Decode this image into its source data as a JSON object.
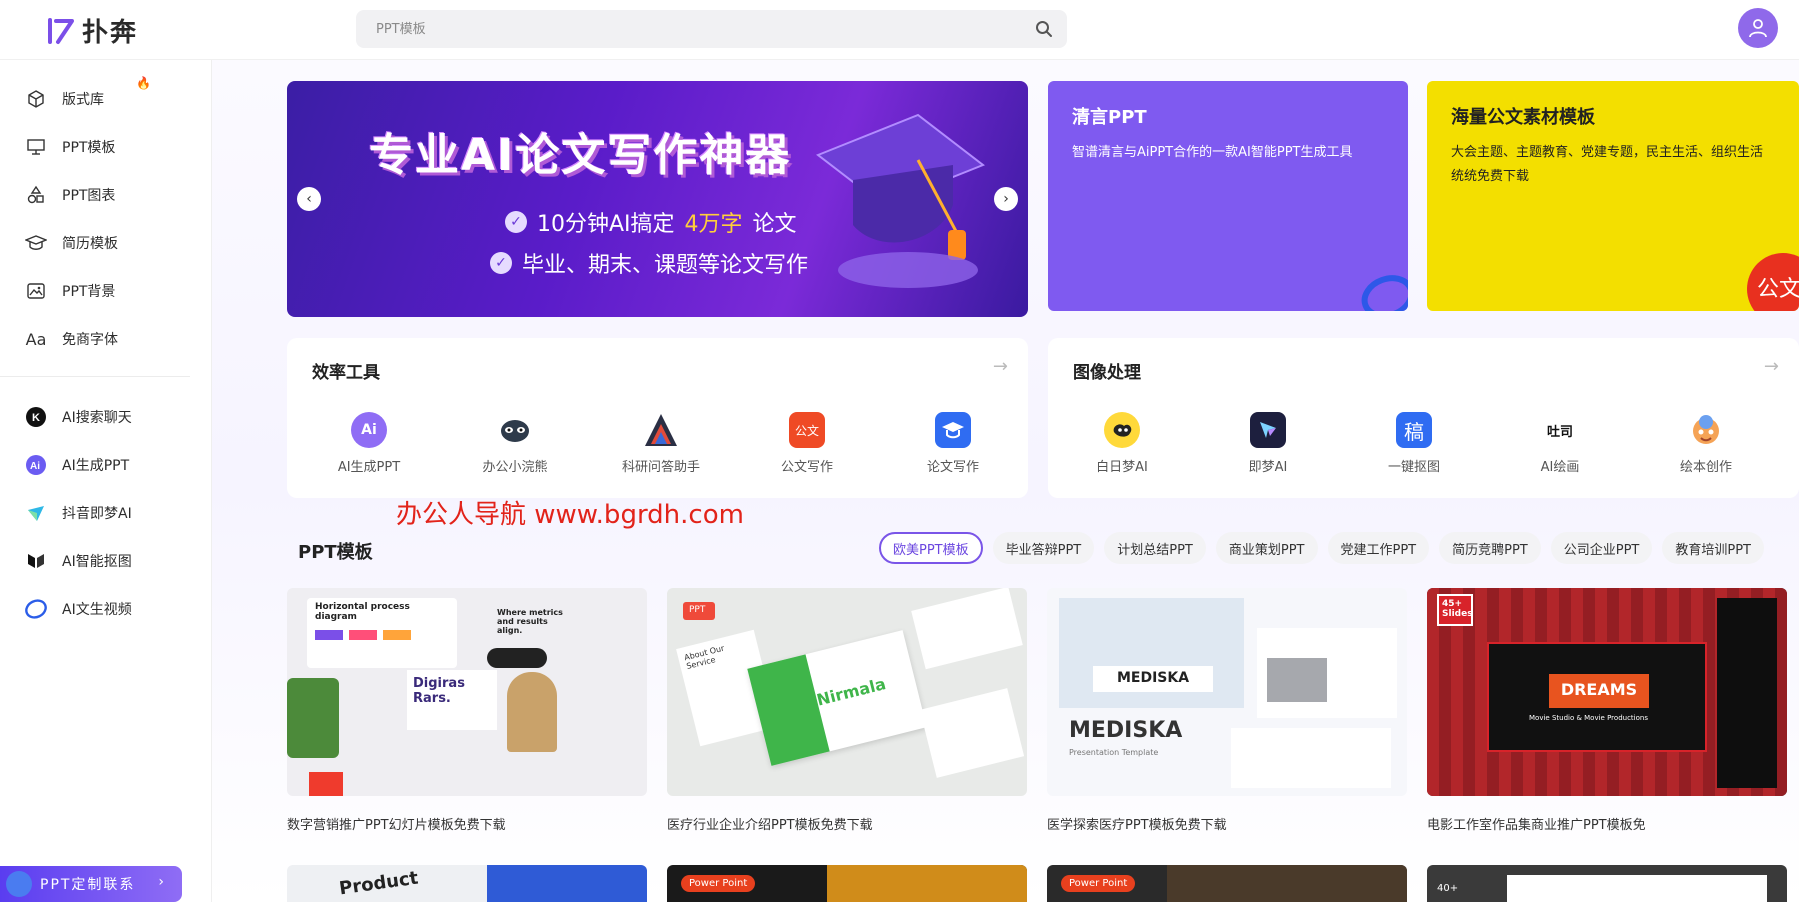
{
  "header": {
    "logo_text": "扑奔",
    "search_placeholder": "PPT模板"
  },
  "sidebar": {
    "items": [
      {
        "label": "版式库"
      },
      {
        "label": "PPT模板"
      },
      {
        "label": "PPT图表"
      },
      {
        "label": "简历模板"
      },
      {
        "label": "PPT背景"
      },
      {
        "label": "免商字体"
      },
      {
        "label": "AI搜索聊天"
      },
      {
        "label": "AI生成PPT"
      },
      {
        "label": "抖音即梦AI"
      },
      {
        "label": "AI智能抠图"
      },
      {
        "label": "AI文生视频"
      }
    ],
    "custom_button": "PPT定制联系"
  },
  "banner": {
    "title": "专业AI论文写作神器",
    "line1_pre": "10分钟AI搞定",
    "line1_hl": "4万字",
    "line1_post": "论文",
    "line2": "毕业、期末、课题等论文写作"
  },
  "promos": [
    {
      "title": "清言PPT",
      "desc": "智谱清言与AiPPT合作的一款AI智能PPT生成工具",
      "color": "#7f5af0"
    },
    {
      "title": "海量公文素材模板",
      "desc": "大会主题、主题教育、党建专题，民主生活、组织生活统统免费下载",
      "color": "#f5e000",
      "badge": "公文"
    }
  ],
  "efficiency": {
    "title": "效率工具",
    "tools": [
      {
        "label": "AI生成PPT",
        "icon": "AI"
      },
      {
        "label": "办公小浣熊",
        "icon": "raccoon"
      },
      {
        "label": "科研问答助手",
        "icon": "A"
      },
      {
        "label": "公文写作",
        "icon": "公文"
      },
      {
        "label": "论文写作",
        "icon": "cap"
      }
    ]
  },
  "image_tools": {
    "title": "图像处理",
    "tools": [
      {
        "label": "白日梦AI",
        "icon": "dream"
      },
      {
        "label": "即梦AI",
        "icon": "star"
      },
      {
        "label": "一键抠图",
        "icon": "稿"
      },
      {
        "label": "AI绘画",
        "icon": "吐司"
      },
      {
        "label": "绘本创作",
        "icon": "face"
      }
    ]
  },
  "watermark": "办公人导航  www.bgrdh.com",
  "ppt_section": {
    "title": "PPT模板",
    "tabs": [
      "欧美PPT模板",
      "毕业答辩PPT",
      "计划总结PPT",
      "商业策划PPT",
      "党建工作PPT",
      "简历竞聘PPT",
      "公司企业PPT",
      "教育培训PPT"
    ],
    "cards": [
      {
        "title": "数字营销推广PPT幻灯片模板免费下载",
        "thumb_text_1": "Horizontal process diagram",
        "thumb_text_2": "Digiras Rars.",
        "thumb_text_3": "Where metrics and results align."
      },
      {
        "title": "医疗行业企业介绍PPT模板免费下载",
        "thumb_text_1": "Nirmala",
        "thumb_text_2": "PPT",
        "thumb_text_3": "About Our Service"
      },
      {
        "title": "医学探索医疗PPT模板免费下载",
        "thumb_text_1": "MEDISKA",
        "thumb_text_2": "MEDISKA",
        "thumb_text_3": "Presentation Template"
      },
      {
        "title": "电影工作室作品集商业推广PPT模板免",
        "thumb_text_1": "DREAMS",
        "thumb_text_2": "45+ Slides",
        "thumb_text_3": "Movie Studio & Movie Productions"
      }
    ],
    "row2": [
      {
        "text": "Product"
      },
      {
        "text": "Power Point"
      },
      {
        "text": "Power Point"
      },
      {
        "text": "40+"
      }
    ]
  }
}
